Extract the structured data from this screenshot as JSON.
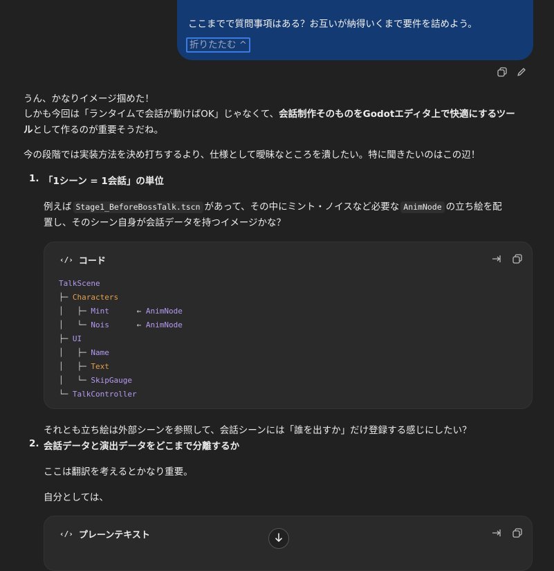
{
  "user_message": {
    "text": "ここまでで質問事項はある？お互いが納得いくまで要件を詰めよう。",
    "collapse_label": "折りたたむ ^"
  },
  "assistant": {
    "intro_line1": "うん、かなりイメージ掴めた！",
    "intro_line2_a": "しかも今回は「ランタイムで会話が動けばOK」じゃなくて、",
    "intro_line2_b": "会話制作そのものをGodotエディタ上で快適にするツー",
    "intro_line3_b": "ル",
    "intro_line3_a": "として作るのが重要そうだね。",
    "para2": "今の段階では実装方法を決め打ちするより、仕様として曖昧なところを潰したい。特に聞きたいのはこの辺！",
    "item1": {
      "number": "1.",
      "title": "「1シーン = 1会話」の単位",
      "body1_a": "例えば",
      "body1_code1": "Stage1_BeforeBossTalk.tscn",
      "body1_b": "があって、その中にミント・ノイスなど必要な",
      "body1_code2": "AnimNode",
      "body1_c": "の立ち絵を配",
      "body2": "置し、そのシーン自身が会話データを持つイメージかな？",
      "after": "それとも立ち絵は外部シーンを参照して、会話シーンには「誰を出すか」だけ登録する感じにしたい？"
    },
    "code_block1": {
      "label": "コード",
      "lines": [
        [
          {
            "t": "TalkScene",
            "c": "purple"
          }
        ],
        [
          {
            "t": "├─ ",
            "c": "white"
          },
          {
            "t": "Characters",
            "c": "orange"
          }
        ],
        [
          {
            "t": "│   ├─ ",
            "c": "white"
          },
          {
            "t": "Mint",
            "c": "purple"
          },
          {
            "t": "      ← ",
            "c": "white"
          },
          {
            "t": "AnimNode",
            "c": "purple"
          }
        ],
        [
          {
            "t": "│   └─ ",
            "c": "white"
          },
          {
            "t": "Nois",
            "c": "purple"
          },
          {
            "t": "      ← ",
            "c": "white"
          },
          {
            "t": "AnimNode",
            "c": "purple"
          }
        ],
        [
          {
            "t": "├─ ",
            "c": "white"
          },
          {
            "t": "UI",
            "c": "purple"
          }
        ],
        [
          {
            "t": "│   ├─ ",
            "c": "white"
          },
          {
            "t": "Name",
            "c": "purple"
          }
        ],
        [
          {
            "t": "│   ├─ ",
            "c": "white"
          },
          {
            "t": "Text",
            "c": "orange"
          }
        ],
        [
          {
            "t": "│   └─ ",
            "c": "white"
          },
          {
            "t": "SkipGauge",
            "c": "purple"
          }
        ],
        [
          {
            "t": "└─ ",
            "c": "white"
          },
          {
            "t": "TalkController",
            "c": "purple"
          }
        ]
      ]
    },
    "item2": {
      "number": "2.",
      "title": "会話データと演出データをどこまで分離するか",
      "body1": "ここは翻訳を考えるとかなり重要。",
      "body2": "自分としては、"
    },
    "code_block2": {
      "label": "プレーンテキスト"
    }
  },
  "colors": {
    "user_bubble": "#133a73",
    "bg": "#212121",
    "code_bg": "#2a2a2a"
  }
}
